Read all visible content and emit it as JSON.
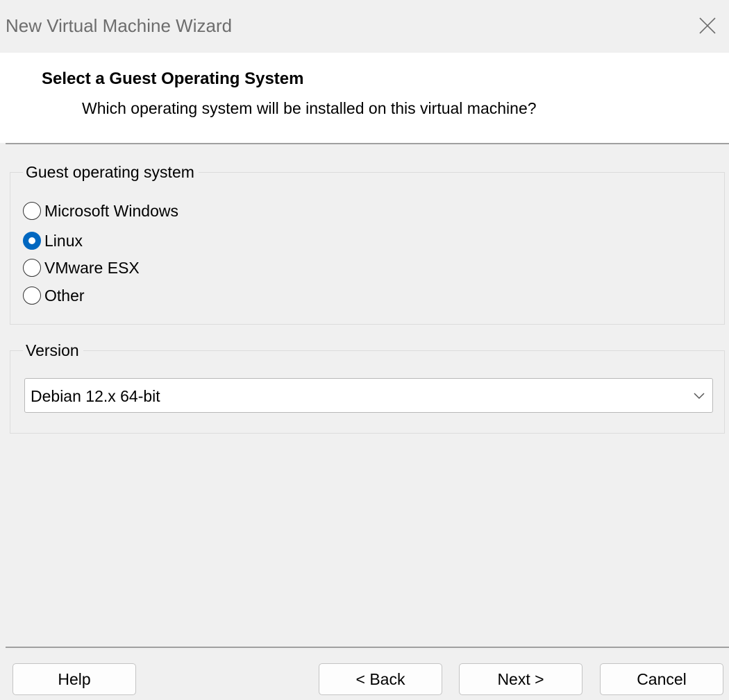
{
  "window": {
    "title": "New Virtual Machine Wizard"
  },
  "header": {
    "title": "Select a Guest Operating System",
    "subtitle": "Which operating system will be installed on this virtual machine?"
  },
  "guest_os": {
    "legend": "Guest operating system",
    "options": [
      {
        "label": "Microsoft Windows",
        "checked": false
      },
      {
        "label": "Linux",
        "checked": true
      },
      {
        "label": "VMware ESX",
        "checked": false
      },
      {
        "label": "Other",
        "checked": false
      }
    ]
  },
  "version": {
    "legend": "Version",
    "selected": "Debian 12.x 64-bit"
  },
  "buttons": {
    "help": "Help",
    "back": "< Back",
    "next": "Next >",
    "cancel": "Cancel"
  },
  "colors": {
    "accent": "#0067c0",
    "background": "#f0f0f0",
    "header_background": "#ffffff"
  },
  "icons": {
    "close": "close-icon",
    "dropdown": "chevron-down-icon"
  }
}
